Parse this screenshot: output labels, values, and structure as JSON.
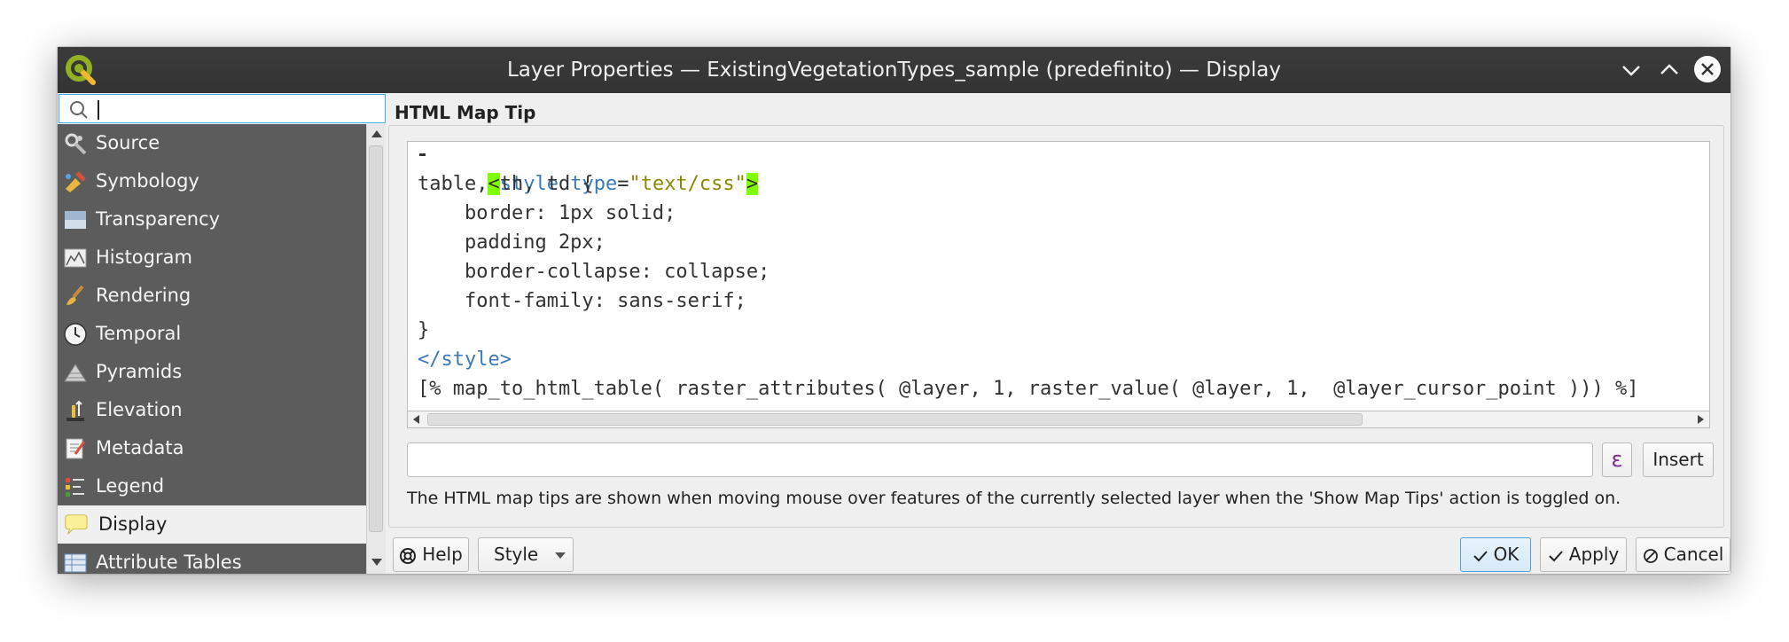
{
  "window": {
    "title": "Layer Properties — ExistingVegetationTypes_sample (predefinito) — Display"
  },
  "search": {
    "value": "",
    "placeholder": ""
  },
  "sidebar": {
    "items": [
      {
        "label": "Source",
        "icon": "wrench-gear-icon"
      },
      {
        "label": "Symbology",
        "icon": "paintbrush-palette-icon"
      },
      {
        "label": "Transparency",
        "icon": "transparency-icon"
      },
      {
        "label": "Histogram",
        "icon": "histogram-icon"
      },
      {
        "label": "Rendering",
        "icon": "brush-icon"
      },
      {
        "label": "Temporal",
        "icon": "clock-icon"
      },
      {
        "label": "Pyramids",
        "icon": "pyramid-icon"
      },
      {
        "label": "Elevation",
        "icon": "elevation-icon"
      },
      {
        "label": "Metadata",
        "icon": "metadata-edit-icon"
      },
      {
        "label": "Legend",
        "icon": "legend-icon"
      },
      {
        "label": "Display",
        "icon": "speech-bubble-icon",
        "selected": true
      },
      {
        "label": "Attribute Tables",
        "icon": "table-icon"
      }
    ]
  },
  "main": {
    "section_title": "HTML Map Tip",
    "code": {
      "line1": {
        "open_bracket": "<",
        "tag": "style",
        "attr": "type",
        "eq": "=",
        "value": "\"text/css\"",
        "close_bracket": ">"
      },
      "line2": "table, th, td {",
      "line3": "    border: 1px solid;",
      "line4": "    padding 2px;",
      "line5": "    border-collapse: collapse;",
      "line6": "    font-family: sans-serif;",
      "line7": "}",
      "line8": "</style>",
      "line9": "[% map_to_html_table( raster_attributes( @layer, 1, raster_value( @layer, 1,  @layer_cursor_point ))) %]"
    },
    "expression_value": "",
    "epsilon_label": "ε",
    "insert_label": "Insert",
    "help_text": "The HTML map tips are shown when moving mouse over features of the currently selected layer when the 'Show Map Tips' action is toggled on."
  },
  "buttons": {
    "help": "Help",
    "style": "Style",
    "ok": "OK",
    "apply": "Apply",
    "cancel": "Cancel"
  },
  "colors": {
    "titlebar": "#353535",
    "sidebar": "#5c5c5c",
    "selection_highlight": "#80ff00",
    "accent": "#3daee9"
  }
}
